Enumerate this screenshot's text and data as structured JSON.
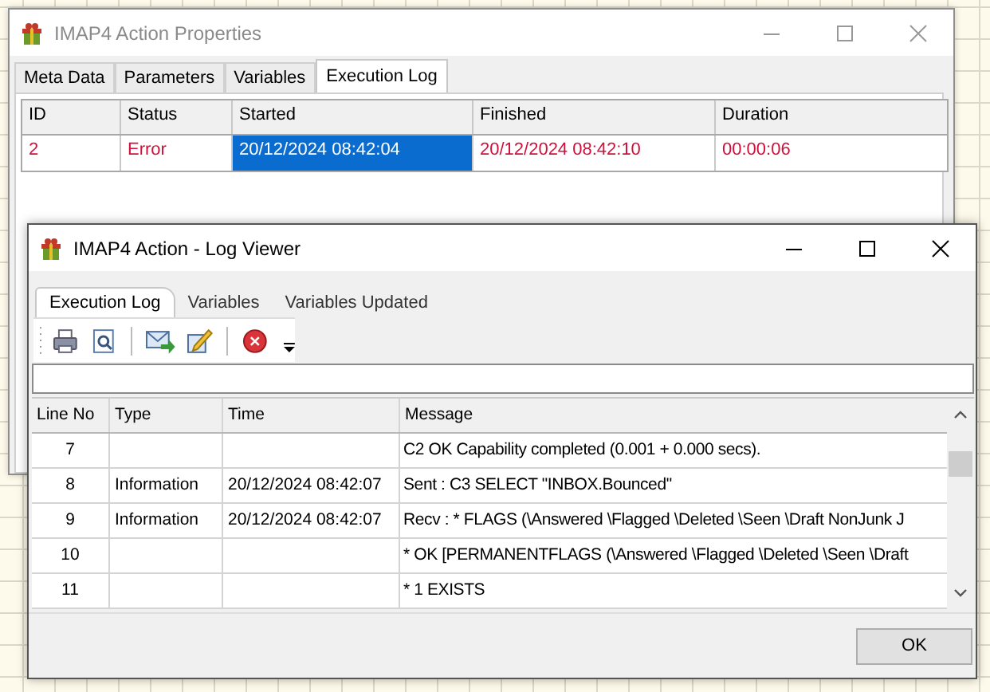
{
  "properties_window": {
    "title": "IMAP4 Action Properties",
    "active": false,
    "tabs": [
      {
        "label": "Meta Data",
        "selected": false
      },
      {
        "label": "Parameters",
        "selected": false
      },
      {
        "label": "Variables",
        "selected": false
      },
      {
        "label": "Execution Log",
        "selected": true
      }
    ],
    "grid": {
      "columns": [
        "ID",
        "Status",
        "Started",
        "Finished",
        "Duration"
      ],
      "rows": [
        {
          "error": true,
          "cells": [
            {
              "text": "2",
              "selected": false
            },
            {
              "text": "Error",
              "selected": false
            },
            {
              "text": "20/12/2024 08:42:04",
              "selected": true
            },
            {
              "text": "20/12/2024 08:42:10",
              "selected": false
            },
            {
              "text": "00:00:06",
              "selected": false
            }
          ]
        }
      ]
    }
  },
  "log_viewer": {
    "title": "IMAP4 Action - Log Viewer",
    "active": true,
    "tabs": [
      {
        "label": "Execution Log",
        "selected": true
      },
      {
        "label": "Variables",
        "selected": false
      },
      {
        "label": "Variables Updated",
        "selected": false
      }
    ],
    "grid": {
      "columns": [
        "Line No",
        "Type",
        "Time",
        "Message"
      ],
      "rows": [
        {
          "line_no": "7",
          "message": "C2 OK Capability completed (0.001 + 0.000 secs)."
        },
        {
          "line_no": "8",
          "type": "Information",
          "time": "20/12/2024 08:42:07",
          "message": "Sent : C3 SELECT \"INBOX.Bounced\""
        },
        {
          "line_no": "9",
          "type": "Information",
          "time": "20/12/2024 08:42:07",
          "message": "Recv : * FLAGS (\\Answered \\Flagged \\Deleted \\Seen \\Draft NonJunk J"
        },
        {
          "line_no": "10",
          "message": "* OK [PERMANENTFLAGS (\\Answered \\Flagged \\Deleted \\Seen \\Draft"
        },
        {
          "line_no": "11",
          "message": "* 1 EXISTS"
        }
      ]
    },
    "buttons": [
      "OK"
    ]
  }
}
